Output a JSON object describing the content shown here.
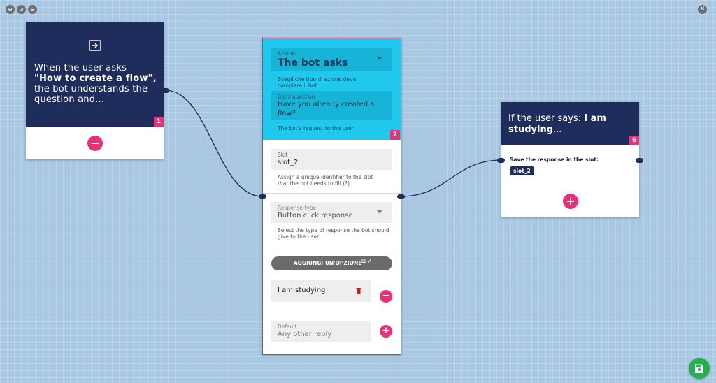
{
  "toolbar": {
    "zoom_in_icon": "zoom-in-icon",
    "reset_icon": "reset-zoom-icon",
    "zoom_out_icon": "zoom-out-icon",
    "close_icon": "close-icon"
  },
  "colors": {
    "navy": "#1f2d5c",
    "pink": "#e9307a",
    "cyan": "#1fc8ec",
    "green": "#27ae4f",
    "canvas": "#a9c8e4"
  },
  "card1": {
    "line1": "When the user asks",
    "bold": "\"How to create a flow\",",
    "rest": " the bot understands the question and...",
    "badge": "1"
  },
  "card2": {
    "badge": "2",
    "action_label": "Azione",
    "action_value": "The bot asks",
    "action_hint": "Scegli che tipo di azione deve compiere il bot",
    "question_label": "Bot's question",
    "question_value": "Have you already created a flow?",
    "question_hint": "The bot's request to the user",
    "slot_label": "Slot",
    "slot_value": "slot_2",
    "slot_hint": "Assign a unique identifier to the slot that the bot needs to fill (?)",
    "response_type_label": "Response type",
    "response_type_value": "Button click response",
    "response_type_hint": "Select the type of response the bot should give to the user",
    "add_option_label": "AGGIUNGI UN'OPZIONE",
    "option1": "I am studying",
    "default_label": "Default",
    "default_placeholder": "Any other reply"
  },
  "card6": {
    "badge": "6",
    "prefix": "If the user says: ",
    "bold": "I am studying",
    "suffix": "...",
    "save_text": "Save the response in the slot:",
    "slot_chip": "slot_2"
  }
}
